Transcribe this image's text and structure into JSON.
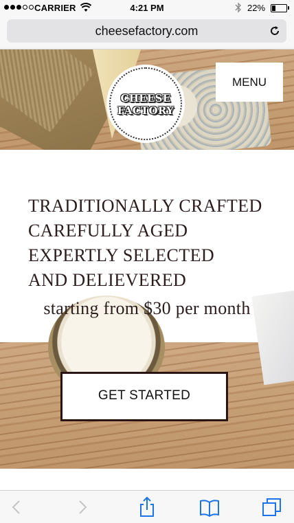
{
  "status_bar": {
    "carrier": "CARRIER",
    "time": "4:21 PM",
    "battery": "22%",
    "battery_level": 0.22,
    "signal_bars_filled": 3,
    "signal_bars_total": 5
  },
  "browser": {
    "url": "cheesefactory.com"
  },
  "header": {
    "menu_label": "MENU"
  },
  "logo": {
    "line1": "CHEESE",
    "line2": "FACTORY"
  },
  "hero": {
    "headline": [
      "TRADITIONALLY CRAFTED",
      "CAREFULLY AGED",
      "EXPERTLY SELECTED",
      "AND DELIEVERED"
    ],
    "price_text": "starting from $30 per month",
    "cta_label": "GET STARTED"
  },
  "toolbar": {
    "icons": [
      "back-icon",
      "forward-icon",
      "share-icon",
      "bookmarks-icon",
      "tabs-icon"
    ],
    "accent_color": "#1a73e8",
    "disabled_color": "#c4c4c4"
  },
  "colors": {
    "headline_text": "#2b1d1d",
    "cta_border": "#2a1414",
    "chrome_bg": "#f7f7f7"
  }
}
